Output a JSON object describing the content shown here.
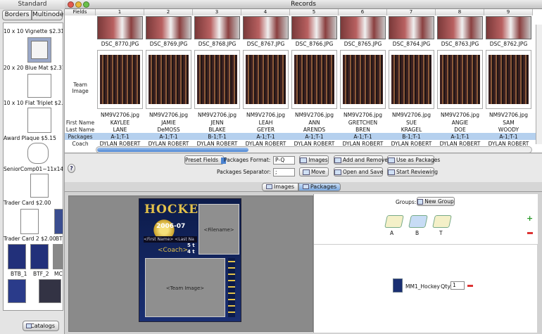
{
  "drawer": {
    "title": "Standard",
    "tabs": [
      "Borders",
      "Multinode"
    ],
    "items": [
      "10 x 10 Vignette $2.31",
      "20 x 20 Blue Mat $2.31",
      "10 x 10 Flat Triplet $2.3",
      "Award Plaque $5.15",
      "SeniorComp01~11x14 $8",
      "Trader Card $2.00",
      "Trader Card 2 $2.00",
      "BTF",
      "BTB_1",
      "BTF_2",
      "MC"
    ],
    "catalogs_label": "Catalogs"
  },
  "window": {
    "title": "Records"
  },
  "grid": {
    "fields_header": "Fields",
    "columns": [
      "1",
      "2",
      "3",
      "4",
      "5",
      "6",
      "7",
      "8",
      "9"
    ],
    "row_labels": {
      "team_image": "Team Image",
      "first_name": "First Name",
      "last_name": "Last Name",
      "packages": "Packages",
      "coach": "Coach"
    },
    "photo_files": [
      "DSC_8770.JPG",
      "DSC_8769.JPG",
      "DSC_8768.JPG",
      "DSC_8767.JPG",
      "DSC_8766.JPG",
      "DSC_8765.JPG",
      "DSC_8764.JPG",
      "DSC_8763.JPG",
      "DSC_8762.JPG"
    ],
    "team_files": [
      "NM9V2706.jpg",
      "NM9V2706.jpg",
      "NM9V2706.jpg",
      "NM9V2706.jpg",
      "NM9V2706.jpg",
      "NM9V2706.jpg",
      "NM9V2706.jpg",
      "NM9V2706.jpg",
      "NM9V2706.jpg"
    ],
    "first_names": [
      "KAYLEE",
      "JAMIE",
      "JENN",
      "LEAH",
      "ANN",
      "GRETCHEN",
      "SUE",
      "ANGIE",
      "SAM"
    ],
    "last_names": [
      "LANE",
      "DeMOSS",
      "BLAKE",
      "GEYER",
      "ARENDS",
      "BREN",
      "KRAGEL",
      "DOE",
      "WOODY"
    ],
    "packages": [
      "A-1;T-1",
      "A-1;T-1",
      "B-1;T-1",
      "A-1;T-1",
      "A-1;T-1",
      "A-1;T-1",
      "B-1;T-1",
      "A-1;T-1",
      "A-1;T-1"
    ],
    "coaches": [
      "DYLAN ROBERT",
      "DYLAN ROBERT",
      "DYLAN ROBERT",
      "DYLAN ROBERT",
      "DYLAN ROBERT",
      "DYLAN ROBERT",
      "DYLAN ROBERT",
      "DYLAN ROBERT",
      "DYLAN ROBERT"
    ]
  },
  "controls": {
    "preset_fields": "Preset Fields",
    "packages_format_label": "Packages Format:",
    "packages_format_value": "P-Q",
    "packages_separator_label": "Packages Separator:",
    "packages_separator_value": ";",
    "images_btn": "Images",
    "move_btn": "Move",
    "add_remove_btn": "Add and Remove",
    "open_save_btn": "Open and Save",
    "use_as_packages_btn": "Use as Packages",
    "start_reviewing_btn": "Start Reviewing",
    "help": "?"
  },
  "tabs": {
    "images": "Images",
    "packages": "Packages"
  },
  "template": {
    "title": "HOCKEY",
    "year": "2006-07",
    "filename": "<Filename>",
    "name_field": "<First Name> <Last Na",
    "coach": "<Coach>",
    "team_image": "<Team Image>",
    "num1": "5 t",
    "num2": "4 t"
  },
  "groups": {
    "label": "Groups:",
    "new_group_btn": "New Group",
    "items": [
      "A",
      "B",
      "T"
    ],
    "package_name": "MM1_Hockey",
    "qty_label": "Qty",
    "qty_value": "1"
  },
  "colors": {
    "selection": "#b5d0ee",
    "card_blue": "#1a2f72",
    "title_gold": "#e2c14a"
  }
}
